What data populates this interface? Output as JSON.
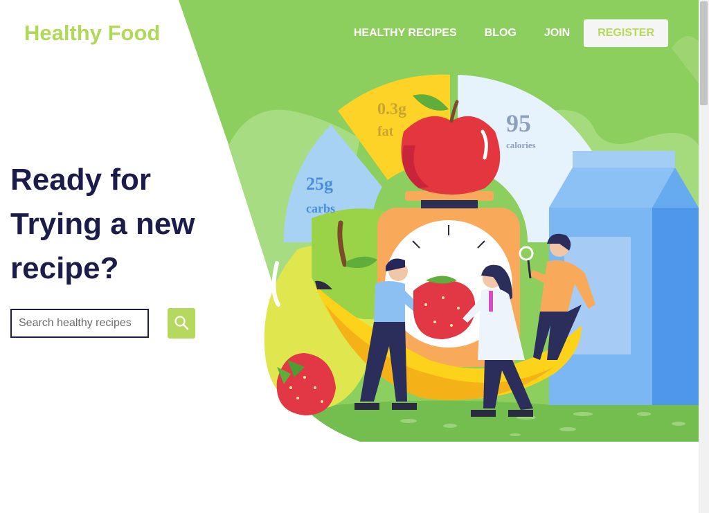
{
  "brand": {
    "logo": "Healthy Food"
  },
  "nav": {
    "items": [
      "HEALTHY RECIPES",
      "BLOG",
      "JOIN"
    ],
    "register": "REGISTER"
  },
  "hero": {
    "headline": "Ready for Trying a new recipe?",
    "search": {
      "placeholder": "Search healthy recipes",
      "value": "",
      "button_icon": "search-icon"
    }
  },
  "nutrition": {
    "fat": {
      "value": "0.3g",
      "label": "fat"
    },
    "calories": {
      "value": "95",
      "label": "calories"
    },
    "carbs": {
      "value": "25g",
      "label": "carbs"
    }
  },
  "colors": {
    "brand": "#b5d958",
    "headline": "#1c1c4a",
    "hero_bg": "#8ccf5e"
  }
}
